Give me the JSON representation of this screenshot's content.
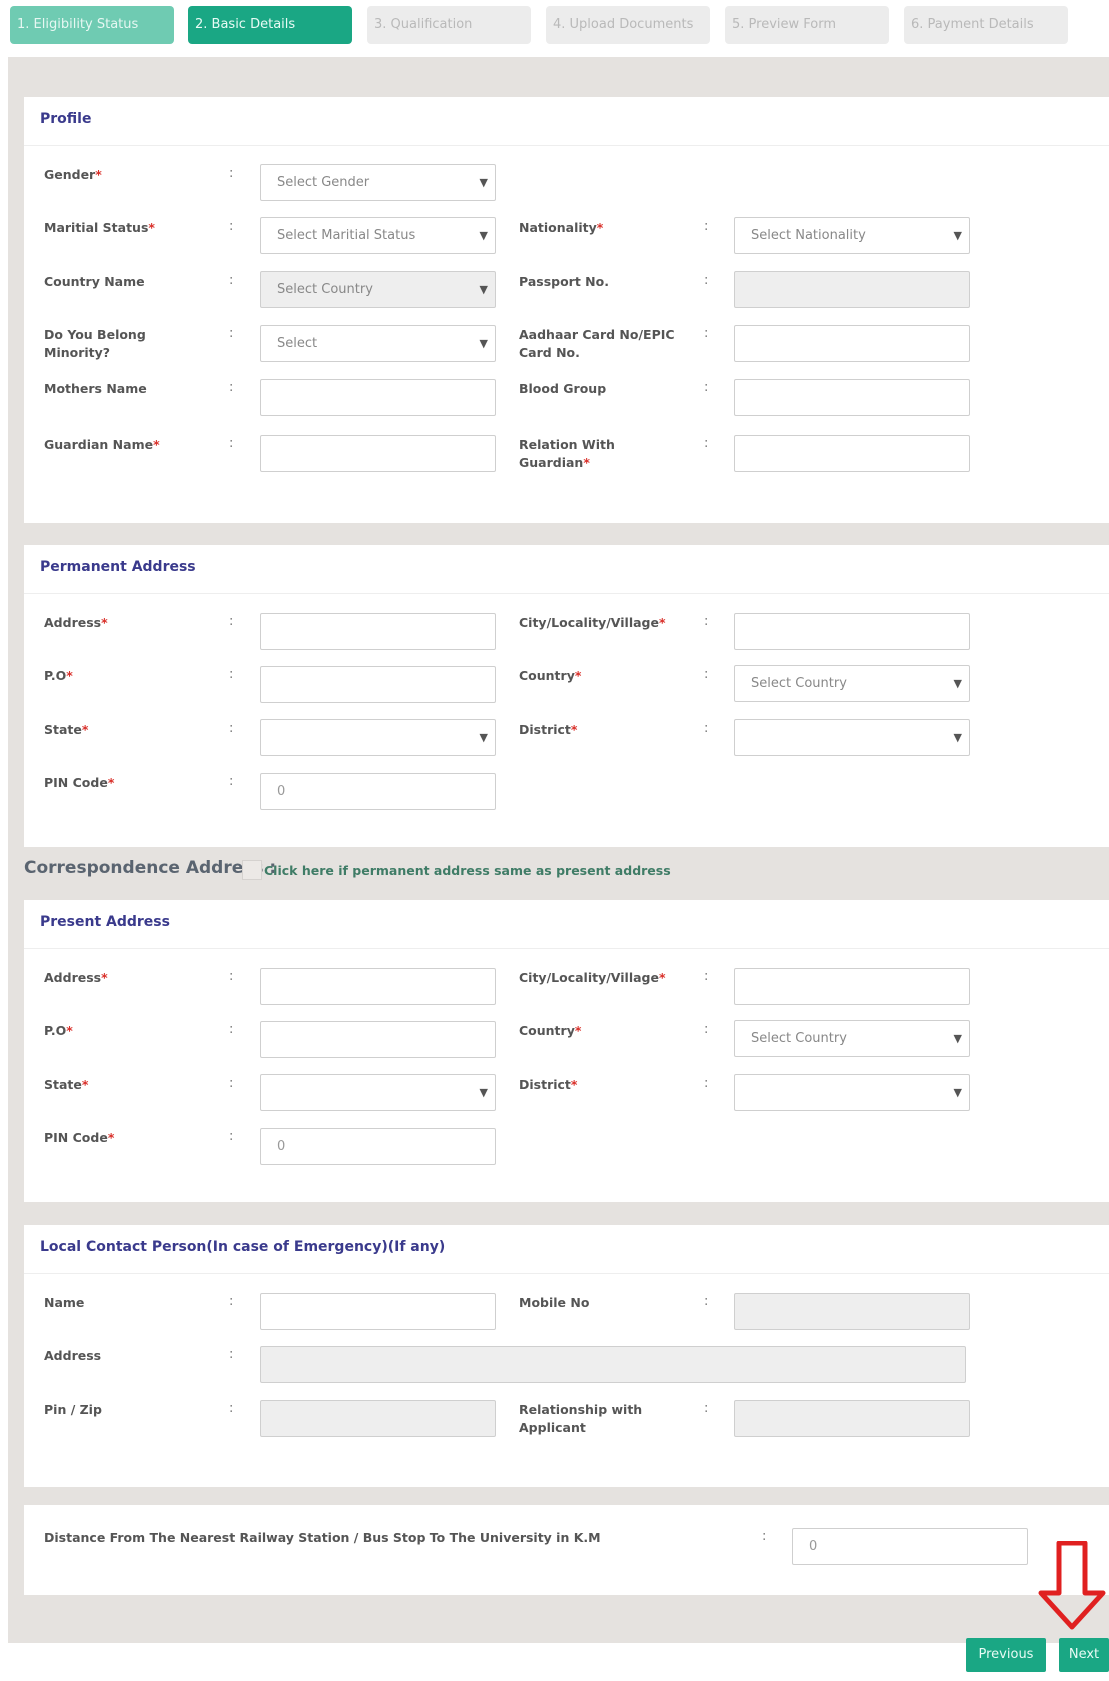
{
  "steps": [
    {
      "label": "1. Eligibility Status",
      "state": "done"
    },
    {
      "label": "2. Basic Details",
      "state": "active"
    },
    {
      "label": "3. Qualification",
      "state": "todo"
    },
    {
      "label": "4. Upload Documents",
      "state": "todo"
    },
    {
      "label": "5. Preview Form",
      "state": "todo"
    },
    {
      "label": "6. Payment Details",
      "state": "todo"
    }
  ],
  "colors": {
    "primary": "#1aa784",
    "step_done": "#6fcbb2",
    "title": "#3a3a8c",
    "required": "#d9302a",
    "arrow": "#e02020"
  },
  "profile": {
    "title": "Profile",
    "gender": {
      "label": "Gender",
      "placeholder": "Select Gender"
    },
    "marital": {
      "label": "Maritial Status",
      "placeholder": "Select Maritial Status"
    },
    "nationality": {
      "label": "Nationality",
      "placeholder": "Select Nationality"
    },
    "country": {
      "label": "Country Name",
      "placeholder": "Select Country"
    },
    "passport": {
      "label": "Passport No."
    },
    "minority": {
      "label_line1": "Do You Belong",
      "label_line2": "Minority?",
      "placeholder": "Select"
    },
    "aadhaar": {
      "label_line1": "Aadhaar Card No/EPIC",
      "label_line2": "Card No."
    },
    "mother": {
      "label": "Mothers Name"
    },
    "blood": {
      "label": "Blood Group"
    },
    "guardian": {
      "label": "Guardian Name"
    },
    "relation": {
      "label_line1": "Relation With",
      "label_line2": "Guardian"
    }
  },
  "permanent": {
    "title": "Permanent Address",
    "address": {
      "label": "Address"
    },
    "city": {
      "label": "City/Locality/Village"
    },
    "po": {
      "label": "P.O"
    },
    "country": {
      "label": "Country",
      "placeholder": "Select Country"
    },
    "state": {
      "label": "State"
    },
    "district": {
      "label": "District"
    },
    "pin": {
      "label": "PIN Code",
      "value": "0"
    }
  },
  "correspondence": {
    "title": "Correspondence Address :",
    "checkbox_text": "Click here if permanent address same as present address"
  },
  "present": {
    "title": "Present Address",
    "address": {
      "label": "Address"
    },
    "city": {
      "label": "City/Locality/Village"
    },
    "po": {
      "label": "P.O"
    },
    "country": {
      "label": "Country",
      "placeholder": "Select Country"
    },
    "state": {
      "label": "State"
    },
    "district": {
      "label": "District"
    },
    "pin": {
      "label": "PIN Code",
      "value": "0"
    }
  },
  "local": {
    "title": "Local Contact Person(In case of Emergency)(If any)",
    "name": {
      "label": "Name"
    },
    "mobile": {
      "label": "Mobile No"
    },
    "address": {
      "label": "Address"
    },
    "pin": {
      "label": "Pin / Zip"
    },
    "relationship": {
      "label_line1": "Relationship with",
      "label_line2": "Applicant"
    }
  },
  "distance": {
    "label": "Distance From The Nearest Railway Station / Bus Stop To The University in K.M",
    "value": "0"
  },
  "buttons": {
    "previous": "Previous",
    "next": "Next"
  },
  "req_mark": "*",
  "colon": ":"
}
